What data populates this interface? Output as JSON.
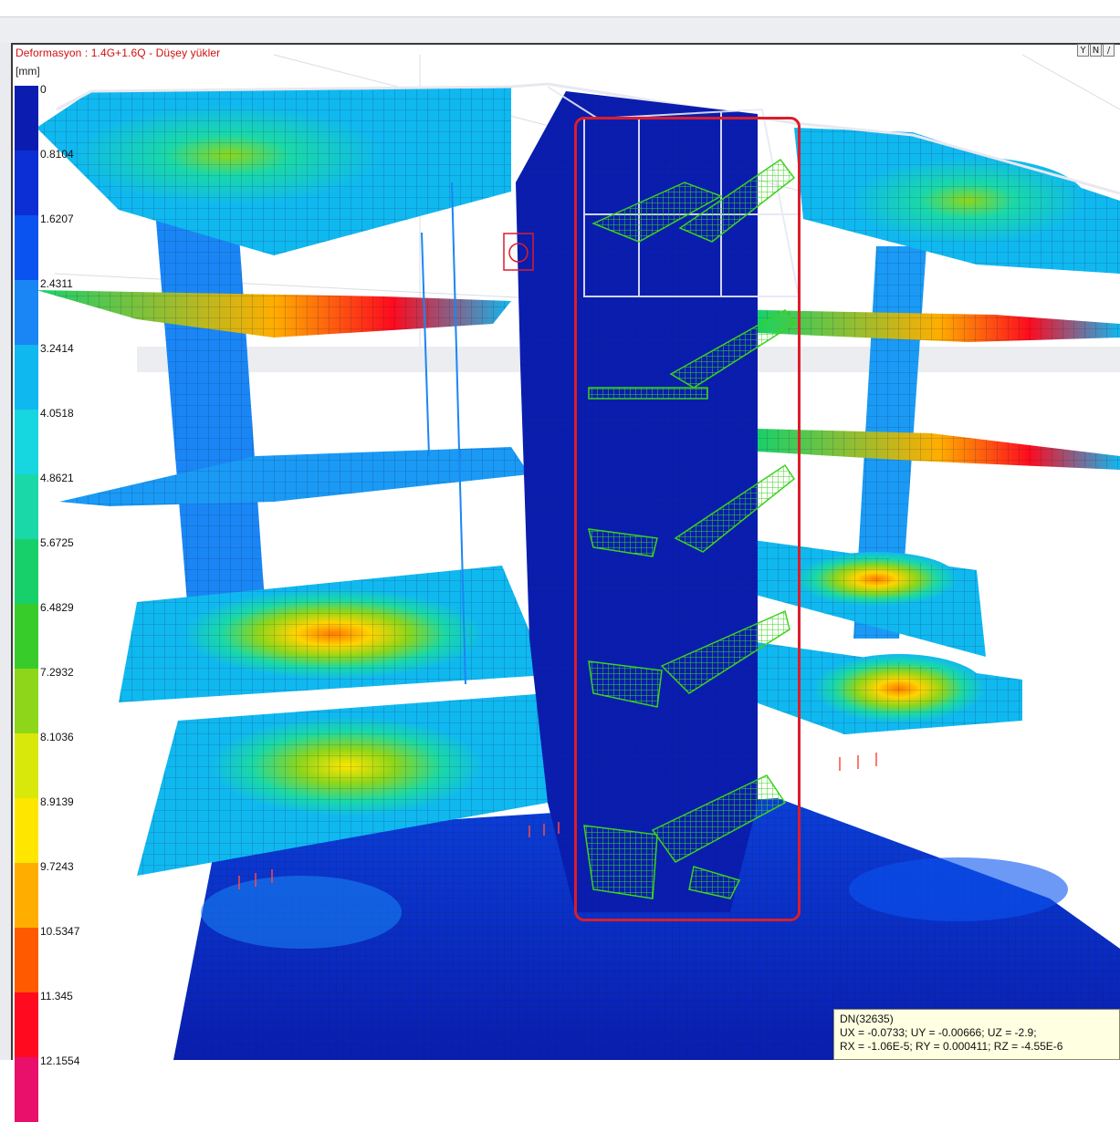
{
  "window": {
    "result_title": "Deformasyon : 1.4G+1.6Q  -  Düşey yükler",
    "unit": "[mm]"
  },
  "legend": {
    "labels": [
      "0",
      "0.8104",
      "1.6207",
      "2.4311",
      "3.2414",
      "4.0518",
      "4.8621",
      "5.6725",
      "6.4829",
      "7.2932",
      "8.1036",
      "8.9139",
      "9.7243",
      "10.5347",
      "11.345",
      "12.1554"
    ],
    "colors": [
      "#0a1db0",
      "#0b2fd4",
      "#0a53f0",
      "#1a86f5",
      "#10b8f0",
      "#16d6e0",
      "#1ad8a8",
      "#18d06a",
      "#38cc2a",
      "#8ed61a",
      "#d8e80a",
      "#ffe600",
      "#ffae00",
      "#ff5a00",
      "#ff0a1e",
      "#e8106a"
    ]
  },
  "view_icons": [
    "Y",
    "N",
    "/"
  ],
  "tooltip": {
    "node": "DN(32635)",
    "line1": "UX = -0.0733; UY = -0.00666; UZ = -2.9;",
    "line2": "RX = -1.06E-5; RY = 0.000411; RZ = -4.55E-6"
  },
  "colors": {
    "title_red": "#d01010",
    "highlight_red": "#dd1c2a",
    "mesh_line": "#0a1a3a"
  }
}
